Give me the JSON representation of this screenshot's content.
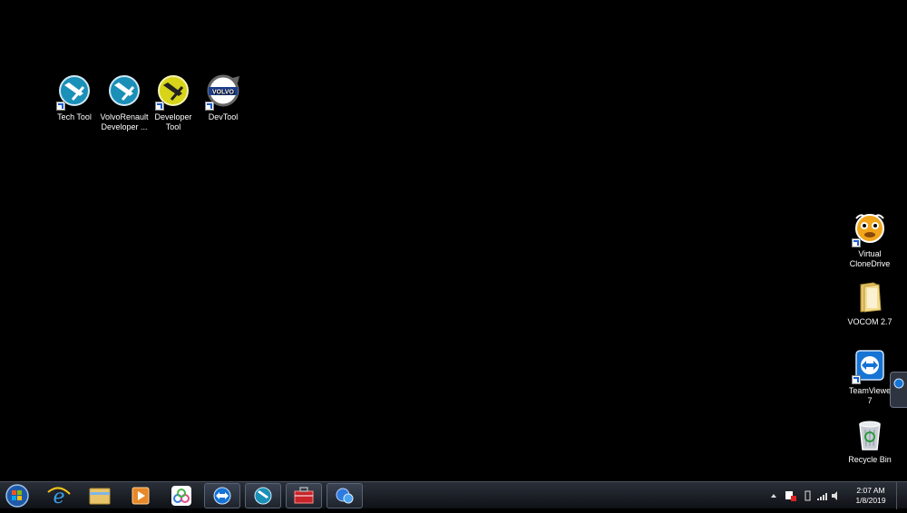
{
  "desktop": {
    "icons_top": [
      {
        "label_line1": "Tech Tool",
        "label_line2": "",
        "icon": "tech-tool-icon"
      },
      {
        "label_line1": "VolvoRenault",
        "label_line2": "Developer ...",
        "icon": "volvo-renault-developer-icon"
      },
      {
        "label_line1": "Developer",
        "label_line2": "Tool",
        "icon": "developer-tool-icon"
      },
      {
        "label_line1": "DevTool",
        "label_line2": "",
        "icon": "volvo-devtool-icon"
      }
    ],
    "icons_right": [
      {
        "label_line1": "Virtual",
        "label_line2": "CloneDrive",
        "icon": "virtual-clonedrive-icon"
      },
      {
        "label_line1": "VOCOM 2.7",
        "label_line2": "",
        "icon": "folder-icon"
      },
      {
        "label_line1": "TeamViewe",
        "label_line2": "7",
        "icon": "teamviewer-icon"
      },
      {
        "label_line1": "Recycle Bin",
        "label_line2": "",
        "icon": "recycle-bin-icon"
      }
    ],
    "volvo_logo_text": "VOLVO"
  },
  "taskbar": {
    "pinned": [
      "start-orb-icon",
      "internet-explorer-icon",
      "file-explorer-icon",
      "media-player-icon",
      "app-icon",
      "teamviewer-icon",
      "tech-tool-icon",
      "toolbox-icon",
      "network-app-icon"
    ],
    "tray_icons": [
      "show-hidden-icons",
      "action-center-icon",
      "battery-icon",
      "network-signal-icon",
      "volume-icon"
    ],
    "clock": {
      "time": "2:07 AM",
      "date": "1/8/2019"
    }
  },
  "colors": {
    "desktop_bg": "#000000",
    "taskbar_bg": "#1a1e24"
  }
}
